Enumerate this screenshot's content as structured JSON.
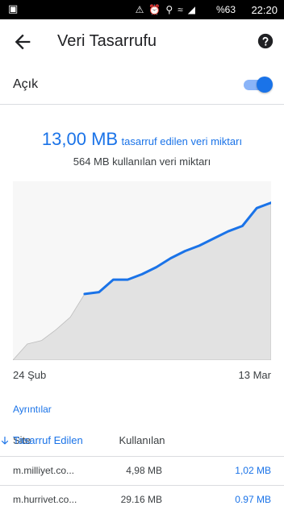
{
  "status_bar": {
    "battery": "%63",
    "time": "22:20"
  },
  "app_bar": {
    "title": "Veri Tasarrufu"
  },
  "toggle": {
    "label": "Açık",
    "enabled": true
  },
  "summary": {
    "saved_amount": "13,00 MB",
    "saved_caption": "tasarruf edilen veri miktarı",
    "used_text": "564 MB kullanılan veri miktarı"
  },
  "chart": {
    "start_label": "24 Şub",
    "end_label": "13 Mar",
    "colors": {
      "used_fill": "#e2e2e2",
      "saved_line": "#1a73e8"
    }
  },
  "chart_data": {
    "type": "area",
    "title": "",
    "xlabel": "",
    "ylabel": "",
    "x": [
      "24 Şub",
      "",
      "",
      "",
      "",
      "",
      "",
      "",
      "",
      "",
      "",
      "",
      "",
      "",
      "",
      "",
      "",
      "",
      "13 Mar"
    ],
    "series": [
      {
        "values": [
          0.0,
          0.09,
          0.11,
          0.17,
          0.24,
          0.37,
          0.38,
          0.45,
          0.45,
          0.48,
          0.52,
          0.57,
          0.61,
          0.64,
          0.68,
          0.72,
          0.75,
          0.85,
          0.88
        ]
      },
      {
        "values": [
          0.0,
          0.0,
          0.0,
          0.0,
          0.0,
          0.37,
          0.38,
          0.45,
          0.45,
          0.48,
          0.52,
          0.57,
          0.61,
          0.64,
          0.68,
          0.72,
          0.75,
          0.85,
          0.88
        ]
      }
    ],
    "ylim": [
      0,
      1
    ],
    "grid": false
  },
  "details_link": "Ayrıntılar",
  "table": {
    "headers": {
      "site": "Site",
      "used": "Kullanılan",
      "saved": "Tasarruf Edilen"
    },
    "rows": [
      {
        "site": "m.milliyet.co...",
        "used": "4,98 MB",
        "saved": "1,02 MB"
      },
      {
        "site": "m.hurrivet.co...",
        "used": "29.16 MB",
        "saved": "0.97 MB"
      }
    ]
  }
}
